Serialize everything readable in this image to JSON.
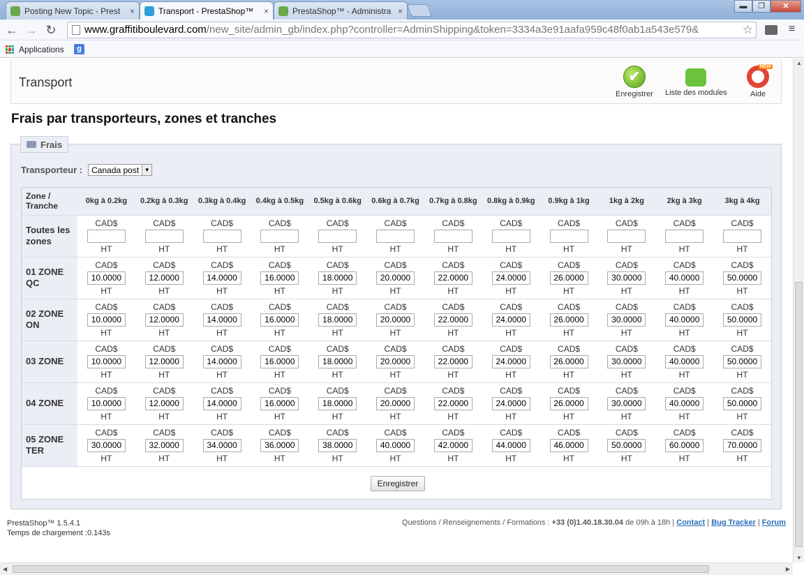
{
  "browser": {
    "tabs": [
      {
        "title": "Posting New Topic - Prest",
        "active": false
      },
      {
        "title": "Transport - PrestaShop™",
        "active": true
      },
      {
        "title": "PrestaShop™ - Administra",
        "active": false
      }
    ],
    "tab_close": "×",
    "window_buttons": {
      "minimize": "▬",
      "maximize": "❐",
      "close": "✕"
    },
    "nav": {
      "back": "←",
      "forward": "→",
      "reload": "↻"
    },
    "url_host": "www.graffitiboulevard.com",
    "url_path": "/new_site/admin_gb/index.php?controller=AdminShipping&token=3334a3e91aafa959c48f0ab1a543e579&",
    "star": "☆",
    "menu": "≡",
    "bookmarks": {
      "apps": "Applications",
      "google": "g"
    }
  },
  "header": {
    "title": "Transport",
    "buttons": {
      "save": "Enregistrer",
      "modules": "Liste des modules",
      "help": "Aide",
      "help_badge": "NEW",
      "save_glyph": "✔"
    }
  },
  "page_title": "Frais par transporteurs, zones et tranches",
  "fees": {
    "legend": "Frais",
    "carrier_label": "Transporteur :",
    "carrier_value": "Canada post",
    "dropdown_glyph": "▼",
    "corner_label": "Zone / Tranche",
    "currency": "CAD$",
    "tax": "HT",
    "ranges": [
      "0kg à 0.2kg",
      "0.2kg à 0.3kg",
      "0.3kg à 0.4kg",
      "0.4kg à 0.5kg",
      "0.5kg à 0.6kg",
      "0.6kg à 0.7kg",
      "0.7kg à 0.8kg",
      "0.8kg à 0.9kg",
      "0.9kg à 1kg",
      "1kg à 2kg",
      "2kg à 3kg",
      "3kg à 4kg"
    ],
    "zones": [
      {
        "name": "Toutes les zones",
        "values": [
          "",
          "",
          "",
          "",
          "",
          "",
          "",
          "",
          "",
          "",
          "",
          ""
        ]
      },
      {
        "name": "01 ZONE QC",
        "values": [
          "10.0000",
          "12.0000",
          "14.0000",
          "16.0000",
          "18.0000",
          "20.0000",
          "22.0000",
          "24.0000",
          "26.0000",
          "30.0000",
          "40.0000",
          "50.0000"
        ]
      },
      {
        "name": "02 ZONE ON",
        "values": [
          "10.0000",
          "12.0000",
          "14.0000",
          "16.0000",
          "18.0000",
          "20.0000",
          "22.0000",
          "24.0000",
          "26.0000",
          "30.0000",
          "40.0000",
          "50.0000"
        ]
      },
      {
        "name": "03 ZONE",
        "values": [
          "10.0000",
          "12.0000",
          "14.0000",
          "16.0000",
          "18.0000",
          "20.0000",
          "22.0000",
          "24.0000",
          "26.0000",
          "30.0000",
          "40.0000",
          "50.0000"
        ]
      },
      {
        "name": "04 ZONE",
        "values": [
          "10.0000",
          "12.0000",
          "14.0000",
          "16.0000",
          "18.0000",
          "20.0000",
          "22.0000",
          "24.0000",
          "26.0000",
          "30.0000",
          "40.0000",
          "50.0000"
        ]
      },
      {
        "name": "05 ZONE TER",
        "values": [
          "30.0000",
          "32.0000",
          "34.0000",
          "36.0000",
          "38.0000",
          "40.0000",
          "42.0000",
          "44.0000",
          "46.0000",
          "50.0000",
          "60.0000",
          "70.0000"
        ]
      }
    ],
    "save_button": "Enregistrer"
  },
  "footer": {
    "version": "PrestaShop™ 1.5.4.1",
    "load_time": "Temps de chargement :0.143s",
    "contact_text": "Questions / Renseignements / Formations :",
    "phone": "+33 (0)1.40.18.30.04",
    "hours": "de 09h à 18h |",
    "links": {
      "contact": "Contact",
      "bug": "Bug Tracker",
      "forum": "Forum"
    },
    "sep": "|"
  },
  "scrollbars": {
    "up": "▲",
    "down": "▼",
    "left": "◀",
    "right": "▶"
  },
  "colors": {
    "accent_link": "#2a6ebb",
    "panel_bg": "#ebeef4"
  }
}
